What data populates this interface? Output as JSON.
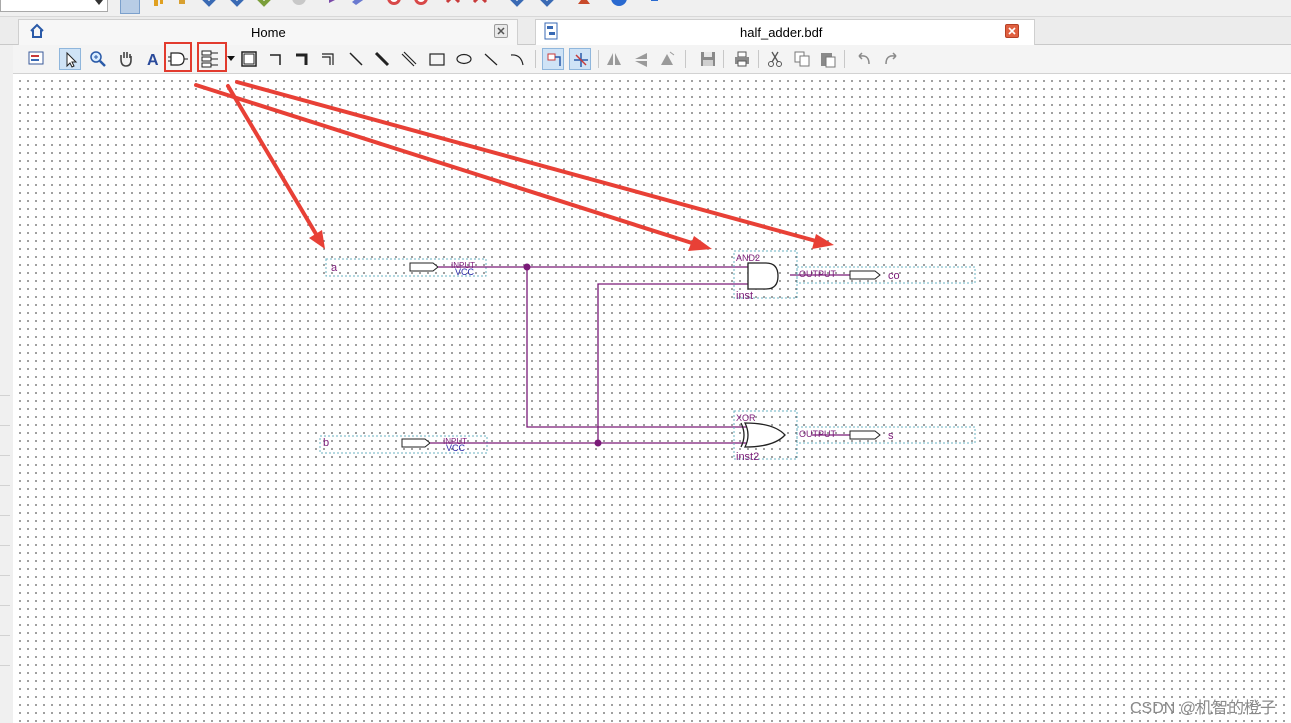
{
  "tabs": {
    "home_label": "Home",
    "doc_label": "half_adder.bdf"
  },
  "schematic": {
    "inputs": [
      {
        "pin_name": "a",
        "pin_type": "INPUT",
        "pin_default": "VCC"
      },
      {
        "pin_name": "b",
        "pin_type": "INPUT",
        "pin_default": "VCC"
      }
    ],
    "outputs": [
      {
        "pin_name": "co",
        "pin_type": "OUTPUT"
      },
      {
        "pin_name": "s",
        "pin_type": "OUTPUT"
      }
    ],
    "gates": [
      {
        "gate_type": "AND2",
        "instance": "inst"
      },
      {
        "gate_type": "XOR",
        "instance": "inst2"
      }
    ]
  },
  "toolbar": {
    "buttons": [
      "compile-project-icon",
      "selection-tool-icon",
      "zoom-tool-icon",
      "hand-tool-icon",
      "text-tool-icon",
      "symbol-tool-icon",
      "pin-tool-icon",
      "rectangle-tool-icon",
      "orthogonal-node-tool-icon",
      "orthogonal-bus-tool-icon",
      "orthogonal-conduit-tool-icon",
      "diagonal-node-tool-icon",
      "diagonal-bus-tool-icon",
      "diagonal-conduit-tool-icon",
      "rectangle-shape-icon",
      "oval-shape-icon",
      "line-shape-icon",
      "arc-shape-icon",
      "rubberbanding-icon",
      "partial-line-selection-icon",
      "flip-horizontal-icon",
      "flip-vertical-icon",
      "rotate-icon",
      "save-icon",
      "print-icon",
      "cut-icon",
      "copy-icon",
      "paste-icon",
      "undo-icon",
      "redo-icon"
    ]
  },
  "colors": {
    "wire": "#7a1a78",
    "annotation": "#e84036",
    "grid_dot": "#4a4a4a",
    "highlight": "#e23b2e"
  },
  "watermark": "CSDN @机智的橙子"
}
